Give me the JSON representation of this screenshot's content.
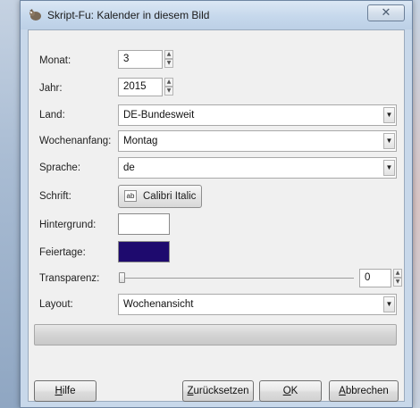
{
  "window": {
    "title": "Skript-Fu: Kalender in diesem Bild",
    "close_label": "✕"
  },
  "form": {
    "monat": {
      "label": "Monat:",
      "value": "3"
    },
    "jahr": {
      "label": "Jahr:",
      "value": "2015"
    },
    "land": {
      "label": "Land:",
      "value": "DE-Bundesweit"
    },
    "wochenanfang": {
      "label": "Wochenanfang:",
      "value": "Montag"
    },
    "sprache": {
      "label": "Sprache:",
      "value": "de"
    },
    "schrift": {
      "label": "Schrift:",
      "value": "Calibri Italic",
      "icon": "font-icon"
    },
    "hintergrund": {
      "label": "Hintergrund:",
      "color": "#ffffff"
    },
    "feiertage": {
      "label": "Feiertage:",
      "color": "#1e0a6e"
    },
    "transparenz": {
      "label": "Transparenz:",
      "value": "0",
      "level": 0
    },
    "layout": {
      "label": "Layout:",
      "value": "Wochenansicht"
    }
  },
  "progress": {
    "level": 0
  },
  "buttons": {
    "hilfe": {
      "mnemonic": "H",
      "rest": "ilfe"
    },
    "zuruecksetzen": {
      "mnemonic": "Z",
      "rest": "urücksetzen"
    },
    "ok": {
      "mnemonic": "O",
      "rest": "K"
    },
    "abbrechen": {
      "mnemonic": "A",
      "rest": "bbrechen"
    }
  },
  "colors": {
    "accent": "#1e0a6e",
    "window_frame": "#c8d8ea",
    "client_bg": "#f0f0f0"
  }
}
